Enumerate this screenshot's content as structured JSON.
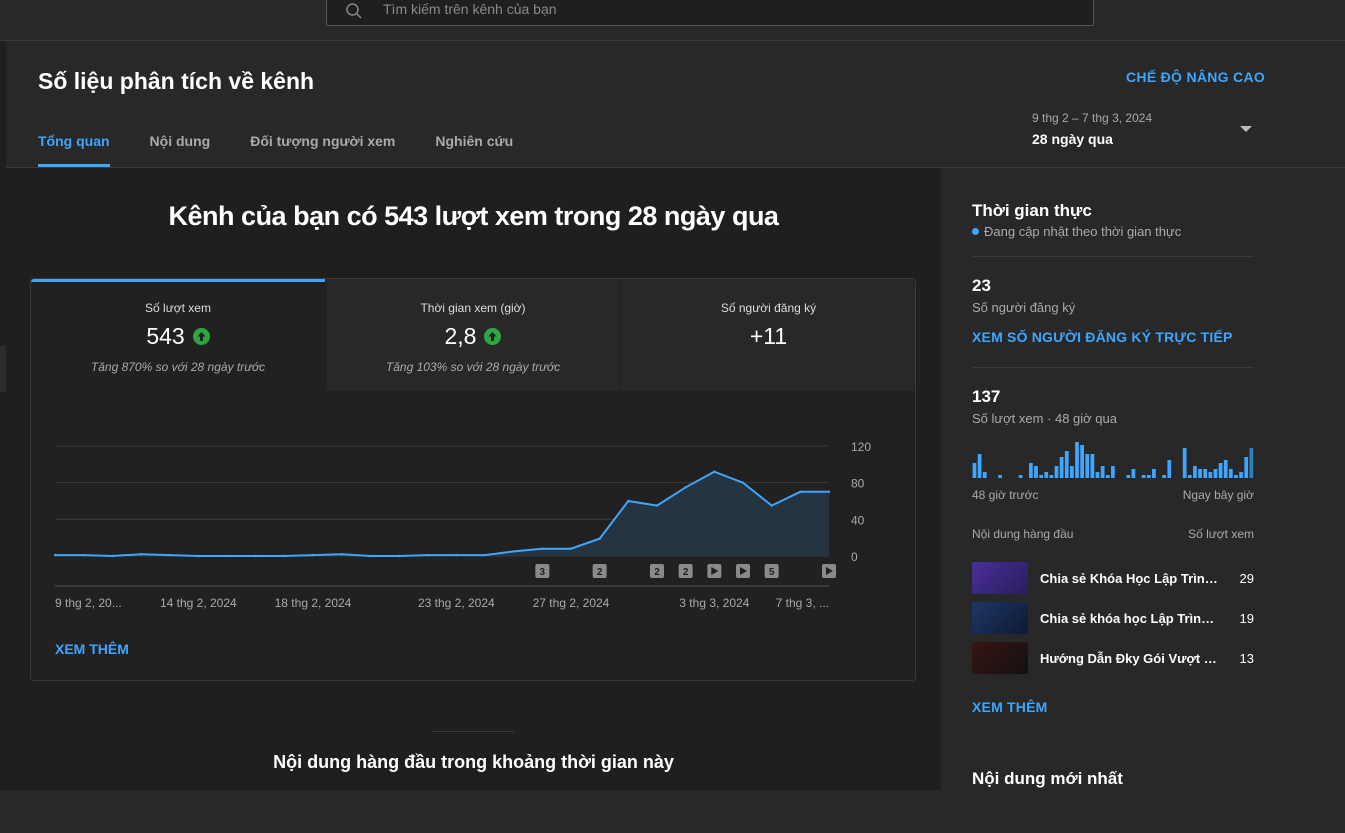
{
  "search": {
    "placeholder": "Tìm kiếm trên kênh của bạn"
  },
  "page": {
    "title": "Số liệu phân tích về kênh",
    "advanced_mode": "CHẾ ĐỘ NÂNG CAO",
    "tabs": [
      {
        "label": "Tổng quan",
        "active": true
      },
      {
        "label": "Nội dung",
        "active": false
      },
      {
        "label": "Đối tượng người xem",
        "active": false
      },
      {
        "label": "Nghiên cứu",
        "active": false
      }
    ],
    "date_range": {
      "dates": "9 thg 2 – 7 thg 3, 2024",
      "label": "28 ngày qua"
    }
  },
  "overview": {
    "headline": "Kênh của bạn có 543 lượt xem trong 28 ngày qua",
    "metrics": [
      {
        "label": "Số lượt xem",
        "value": "543",
        "note": "Tăng 870% so với 28 ngày trước",
        "trend": "up",
        "active": true
      },
      {
        "label": "Thời gian xem (giờ)",
        "value": "2,8",
        "note": "Tăng 103% so với 28 ngày trước",
        "trend": "up",
        "active": false
      },
      {
        "label": "Số người đăng ký",
        "value": "+11",
        "note": "",
        "trend": "none",
        "active": false
      }
    ],
    "more_label": "XEM THÊM",
    "top_content_title": "Nội dung hàng đầu trong khoảng thời gian này"
  },
  "chart_data": {
    "type": "area",
    "title": "",
    "x": [
      "9 thg 2",
      "10 thg 2",
      "11 thg 2",
      "12 thg 2",
      "13 thg 2",
      "14 thg 2",
      "15 thg 2",
      "16 thg 2",
      "17 thg 2",
      "18 thg 2",
      "19 thg 2",
      "20 thg 2",
      "21 thg 2",
      "22 thg 2",
      "23 thg 2",
      "24 thg 2",
      "25 thg 2",
      "26 thg 2",
      "27 thg 2",
      "28 thg 2",
      "29 thg 2",
      "1 thg 3",
      "2 thg 3",
      "3 thg 3",
      "4 thg 3",
      "5 thg 3",
      "6 thg 3",
      "7 thg 3"
    ],
    "series": [
      {
        "values": [
          1,
          1,
          0,
          2,
          1,
          0,
          0,
          0,
          0,
          1,
          2,
          0,
          0,
          1,
          1,
          1,
          5,
          8,
          8,
          19,
          60,
          55,
          75,
          92,
          80,
          55,
          70,
          70
        ]
      }
    ],
    "x_tick_labels": [
      "9 thg 2, 20...",
      "14 thg 2, 2024",
      "18 thg 2, 2024",
      "23 thg 2, 2024",
      "27 thg 2, 2024",
      "3 thg 3, 2024",
      "7 thg 3, ..."
    ],
    "y_ticks": [
      0,
      40,
      80,
      120
    ],
    "ylim": [
      0,
      120
    ],
    "markers": [
      {
        "index": 17,
        "label": "3",
        "kind": "count"
      },
      {
        "index": 19,
        "label": "2",
        "kind": "count"
      },
      {
        "index": 21,
        "label": "2",
        "kind": "count"
      },
      {
        "index": 22,
        "label": "2",
        "kind": "count"
      },
      {
        "index": 23,
        "label": "",
        "kind": "play"
      },
      {
        "index": 24,
        "label": "",
        "kind": "play"
      },
      {
        "index": 25,
        "label": "5",
        "kind": "count"
      },
      {
        "index": 27,
        "label": "",
        "kind": "play"
      }
    ],
    "grid": true,
    "colors": {
      "line": "#3ea6ff",
      "fill": "#263340"
    }
  },
  "realtime": {
    "title": "Thời gian thực",
    "subtitle": "Đang cập nhật theo thời gian thực",
    "subscribers": "23",
    "subscribers_label": "Số người đăng ký",
    "live_link": "XEM SỐ NGƯỜI ĐĂNG KÝ TRỰC TIẾP",
    "views": "137",
    "views_label": "Số lượt xem · 48 giờ qua",
    "bars": [
      5,
      8,
      2,
      0,
      0,
      1,
      0,
      0,
      0,
      1,
      0,
      5,
      4,
      1,
      2,
      1,
      4,
      7,
      9,
      4,
      12,
      11,
      8,
      8,
      2,
      4,
      1,
      4,
      0,
      0,
      1,
      3,
      0,
      1,
      1,
      3,
      0,
      1,
      6,
      0,
      0,
      10,
      1,
      4,
      3,
      3,
      2,
      3,
      5,
      6,
      3,
      1,
      2,
      7,
      10
    ],
    "axis_left": "48 giờ trước",
    "axis_right": "Ngay bây giờ",
    "top_content_label": "Nội dung hàng đầu",
    "top_views_label": "Số lượt xem",
    "top_items": [
      {
        "title": "Chia sẻ Khóa Học Lập Trình ...",
        "views": "29",
        "thumb": "#3b2a7a"
      },
      {
        "title": "Chia sẻ khóa học Lập Trình ...",
        "views": "19",
        "thumb": "#1c2a4a"
      },
      {
        "title": "Hướng Dẫn Đky Gói Vượt Lin...",
        "views": "13",
        "thumb": "#2a1212"
      }
    ],
    "more_label": "XEM THÊM",
    "bar_color": "#3ea6ff"
  },
  "newest": {
    "title": "Nội dung mới nhất"
  }
}
